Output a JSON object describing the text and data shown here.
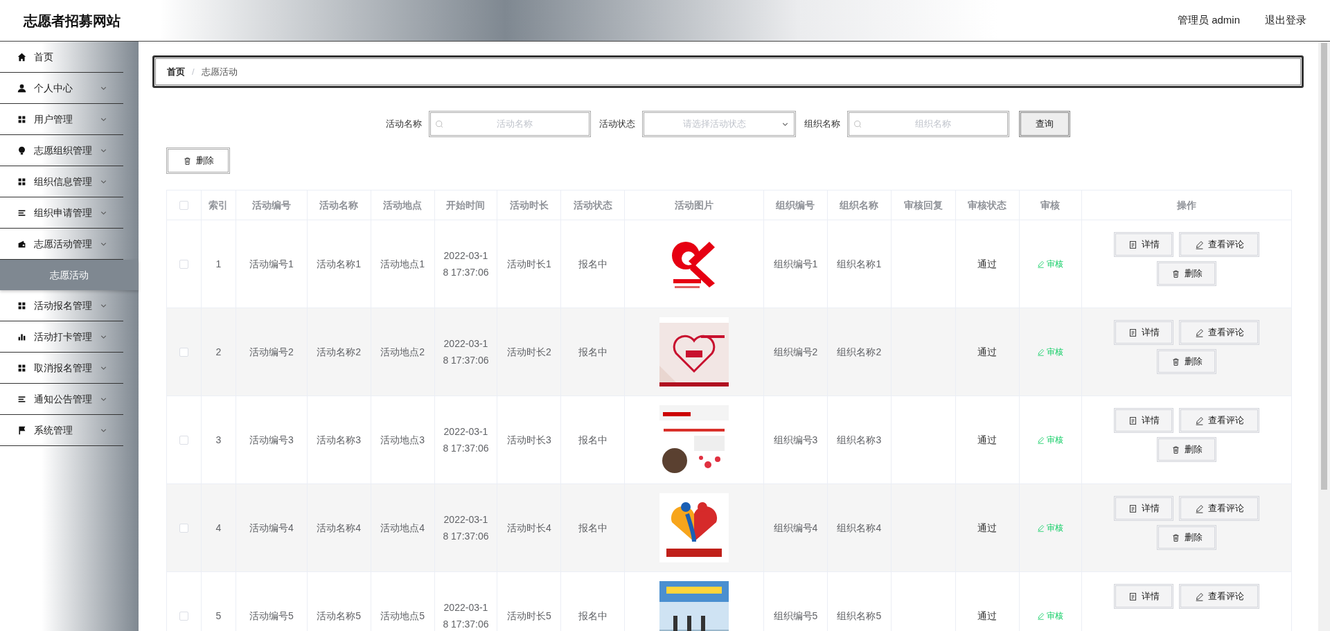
{
  "header": {
    "title": "志愿者招募网站",
    "user": "管理员 admin",
    "logout": "退出登录"
  },
  "sidebar": {
    "items": [
      {
        "label": "首页",
        "expandable": false,
        "selected": false
      },
      {
        "label": "个人中心",
        "expandable": true,
        "selected": false
      },
      {
        "label": "用户管理",
        "expandable": true,
        "selected": false
      },
      {
        "label": "志愿组织管理",
        "expandable": true,
        "selected": false
      },
      {
        "label": "组织信息管理",
        "expandable": true,
        "selected": false
      },
      {
        "label": "组织申请管理",
        "expandable": true,
        "selected": false
      },
      {
        "label": "志愿活动管理",
        "expandable": true,
        "selected": false,
        "children": [
          {
            "label": "志愿活动",
            "selected": true
          }
        ]
      },
      {
        "label": "活动报名管理",
        "expandable": true,
        "selected": false
      },
      {
        "label": "活动打卡管理",
        "expandable": true,
        "selected": false
      },
      {
        "label": "取消报名管理",
        "expandable": true,
        "selected": false
      },
      {
        "label": "通知公告管理",
        "expandable": true,
        "selected": false
      },
      {
        "label": "系统管理",
        "expandable": true,
        "selected": false
      }
    ]
  },
  "breadcrumb": {
    "separator": "/",
    "items": [
      "首页",
      "志愿活动"
    ]
  },
  "filters": [
    {
      "kind": "text",
      "label": "活动名称",
      "placeholder": "活动名称"
    },
    {
      "kind": "select",
      "label": "活动状态",
      "placeholder": "请选择活动状态"
    },
    {
      "kind": "text",
      "label": "组织名称",
      "placeholder": "组织名称"
    }
  ],
  "search_button": "查询",
  "delete_button": "删除",
  "table": {
    "all_checked": false,
    "columns": [
      "索引",
      "活动编号",
      "活动名称",
      "活动地点",
      "开始时间",
      "活动时长",
      "活动状态",
      "活动图片",
      "组织编号",
      "组织名称",
      "审核回复",
      "审核状态",
      "审核",
      "操作"
    ],
    "rows": [
      {
        "checked": false,
        "cells": [
          "1",
          "活动编号1",
          "活动名称1",
          "活动地点1",
          "2022-03-18 17:37:06",
          "活动时长1",
          "报名中"
        ],
        "picture": {
          "kind": "picture"
        },
        "org": [
          "组织编号1",
          "组织名称1"
        ],
        "audit_status": "通过",
        "audit": "审核",
        "actions": [
          "详情",
          "查看评论",
          "删除"
        ]
      },
      {
        "checked": false,
        "cells": [
          "2",
          "活动编号2",
          "活动名称2",
          "活动地点2",
          "2022-03-18 17:37:06",
          "活动时长2",
          "报名中"
        ],
        "picture": {
          "kind": "picture"
        },
        "org": [
          "组织编号2",
          "组织名称2"
        ],
        "audit_status": "通过",
        "audit": "审核",
        "actions": [
          "详情",
          "查看评论",
          "删除"
        ]
      },
      {
        "checked": false,
        "cells": [
          "3",
          "活动编号3",
          "活动名称3",
          "活动地点3",
          "2022-03-18 17:37:06",
          "活动时长3",
          "报名中"
        ],
        "picture": {
          "kind": "picture"
        },
        "org": [
          "组织编号3",
          "组织名称3"
        ],
        "audit_status": "通过",
        "audit": "审核",
        "actions": [
          "详情",
          "查看评论",
          "删除"
        ]
      },
      {
        "checked": false,
        "cells": [
          "4",
          "活动编号4",
          "活动名称4",
          "活动地点4",
          "2022-03-18 17:37:06",
          "活动时长4",
          "报名中"
        ],
        "picture": {
          "kind": "picture"
        },
        "org": [
          "组织编号4",
          "组织名称4"
        ],
        "audit_status": "通过",
        "audit": "审核",
        "actions": [
          "详情",
          "查看评论",
          "删除"
        ]
      },
      {
        "checked": false,
        "cells": [
          "5",
          "活动编号5",
          "活动名称5",
          "活动地点5",
          "2022-03-18 17:37:06",
          "活动时长5",
          "报名中"
        ],
        "picture": {
          "kind": "picture"
        },
        "org": [
          "组织编号5",
          "组织名称5"
        ],
        "audit_status": "通过",
        "audit": "审核",
        "actions": [
          "详情",
          "查看评论"
        ]
      }
    ]
  }
}
